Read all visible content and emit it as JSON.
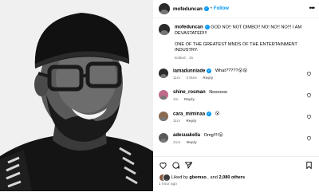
{
  "post": {
    "author": "mofeduncan",
    "follow_label": "Follow",
    "separator": "•",
    "more_label": "•••",
    "caption_line1": "GOD NO!! NOT DIMBO!! NO! NO!! NO!!! I AM DEVASTATED!!!",
    "caption_line2": "ONE OF THE GREATEST MNDS OF THE ENTERTAINMENT INDUSTRY.",
    "caption_edited": "Edited · 1h"
  },
  "comments": [
    {
      "user": "iamadunniade",
      "verified": true,
      "text": "What?????😮😮",
      "time": "11m",
      "likes": "3 likes",
      "reply": "Reply"
    },
    {
      "user": "shine_rosman",
      "verified": false,
      "text": "Noooooo",
      "time": "2m",
      "likes": "",
      "reply": "Reply"
    },
    {
      "user": "cara_miminaa",
      "verified": true,
      "text": "😮",
      "time": "11m",
      "likes": "",
      "reply": "Reply"
    },
    {
      "user": "adesuakella",
      "verified": false,
      "text": "Omg!!!!😮",
      "time": "21m",
      "likes": "",
      "reply": "Reply"
    }
  ],
  "footer": {
    "liked_by_prefix": "Liked by",
    "liked_by_user": "gbemso_",
    "liked_by_suffix": "and",
    "liked_by_count": "2,080 others",
    "timestamp": "1 hour ago"
  },
  "icons": {
    "verified_color": "#0095f6",
    "like": "heart-icon",
    "comment": "comment-icon",
    "share": "share-icon",
    "save": "bookmark-icon"
  }
}
